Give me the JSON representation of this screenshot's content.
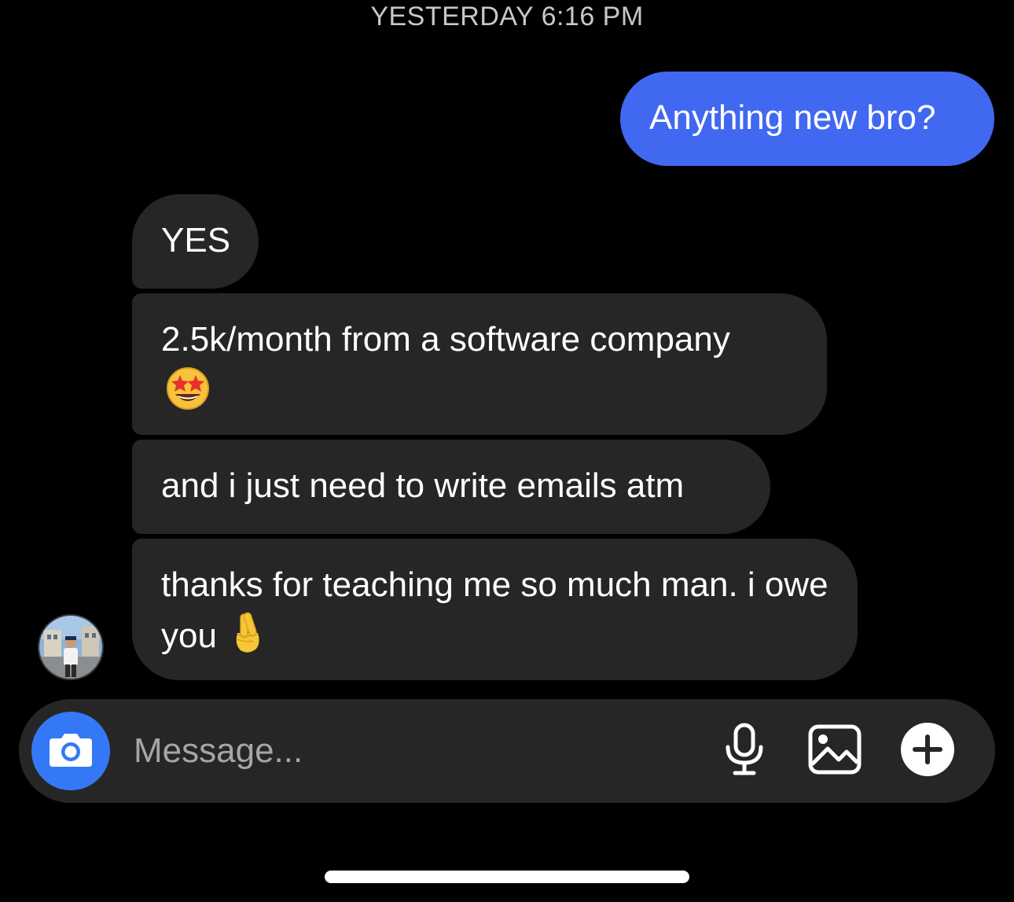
{
  "conversation": {
    "timestamp": "YESTERDAY 6:16 PM",
    "messages": [
      {
        "direction": "outgoing",
        "text": "Anything new bro?"
      },
      {
        "direction": "incoming",
        "text": "YES"
      },
      {
        "direction": "incoming",
        "text": "2.5k/month from a software company",
        "emoji": "star-struck-emoji"
      },
      {
        "direction": "incoming",
        "text": "and i just need to write emails atm"
      },
      {
        "direction": "incoming",
        "text": "thanks for teaching me so much man. i owe you",
        "emoji": "crossed-fingers-emoji"
      }
    ]
  },
  "composer": {
    "placeholder": "Message...",
    "icons": [
      "camera-icon",
      "microphone-icon",
      "gallery-icon",
      "plus-icon"
    ]
  },
  "colors": {
    "background": "#000000",
    "outgoing_bubble": "#4168f0",
    "incoming_bubble": "#262626",
    "camera_button": "#3478f6",
    "composer_bg": "#262626"
  }
}
